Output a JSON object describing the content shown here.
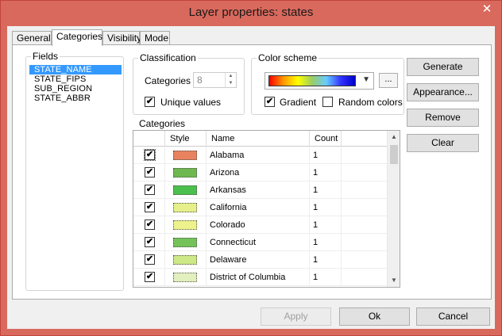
{
  "window": {
    "title": "Layer properties: states",
    "close_glyph": "✕"
  },
  "tabs": [
    {
      "label": "General"
    },
    {
      "label": "Categories",
      "active": true
    },
    {
      "label": "Visibility"
    },
    {
      "label": "Mode"
    }
  ],
  "fields": {
    "label": "Fields",
    "items": [
      "STATE_NAME",
      "STATE_FIPS",
      "SUB_REGION",
      "STATE_ABBR"
    ],
    "selected": "STATE_NAME"
  },
  "classification": {
    "label": "Classification",
    "categories_label": "Categories",
    "categories_value": "8",
    "unique_values_label": "Unique values",
    "unique_values_checked": true
  },
  "color_scheme": {
    "label": "Color scheme",
    "more_button": "...",
    "gradient_label": "Gradient",
    "gradient_checked": true,
    "random_label": "Random colors",
    "random_checked": false
  },
  "side_buttons": {
    "generate": "Generate",
    "appearance": "Appearance...",
    "remove": "Remove",
    "clear": "Clear"
  },
  "categories_grid": {
    "label": "Categories",
    "headers": [
      "Style",
      "Name",
      "Count"
    ],
    "rows": [
      {
        "name": "Alabama",
        "count": "1",
        "color": "#e8825f",
        "checked": true
      },
      {
        "name": "Arizona",
        "count": "1",
        "color": "#6fb84f",
        "checked": true
      },
      {
        "name": "Arkansas",
        "count": "1",
        "color": "#4cc04c",
        "checked": true
      },
      {
        "name": "California",
        "count": "1",
        "color": "#e6f08a",
        "checked": true
      },
      {
        "name": "Colorado",
        "count": "1",
        "color": "#eef28c",
        "checked": true
      },
      {
        "name": "Connecticut",
        "count": "1",
        "color": "#74c25a",
        "checked": true
      },
      {
        "name": "Delaware",
        "count": "1",
        "color": "#cde886",
        "checked": true
      },
      {
        "name": "District of Columbia",
        "count": "1",
        "color": "#e2efbe",
        "checked": true
      }
    ]
  },
  "footer": {
    "apply": "Apply",
    "ok": "Ok",
    "cancel": "Cancel"
  }
}
